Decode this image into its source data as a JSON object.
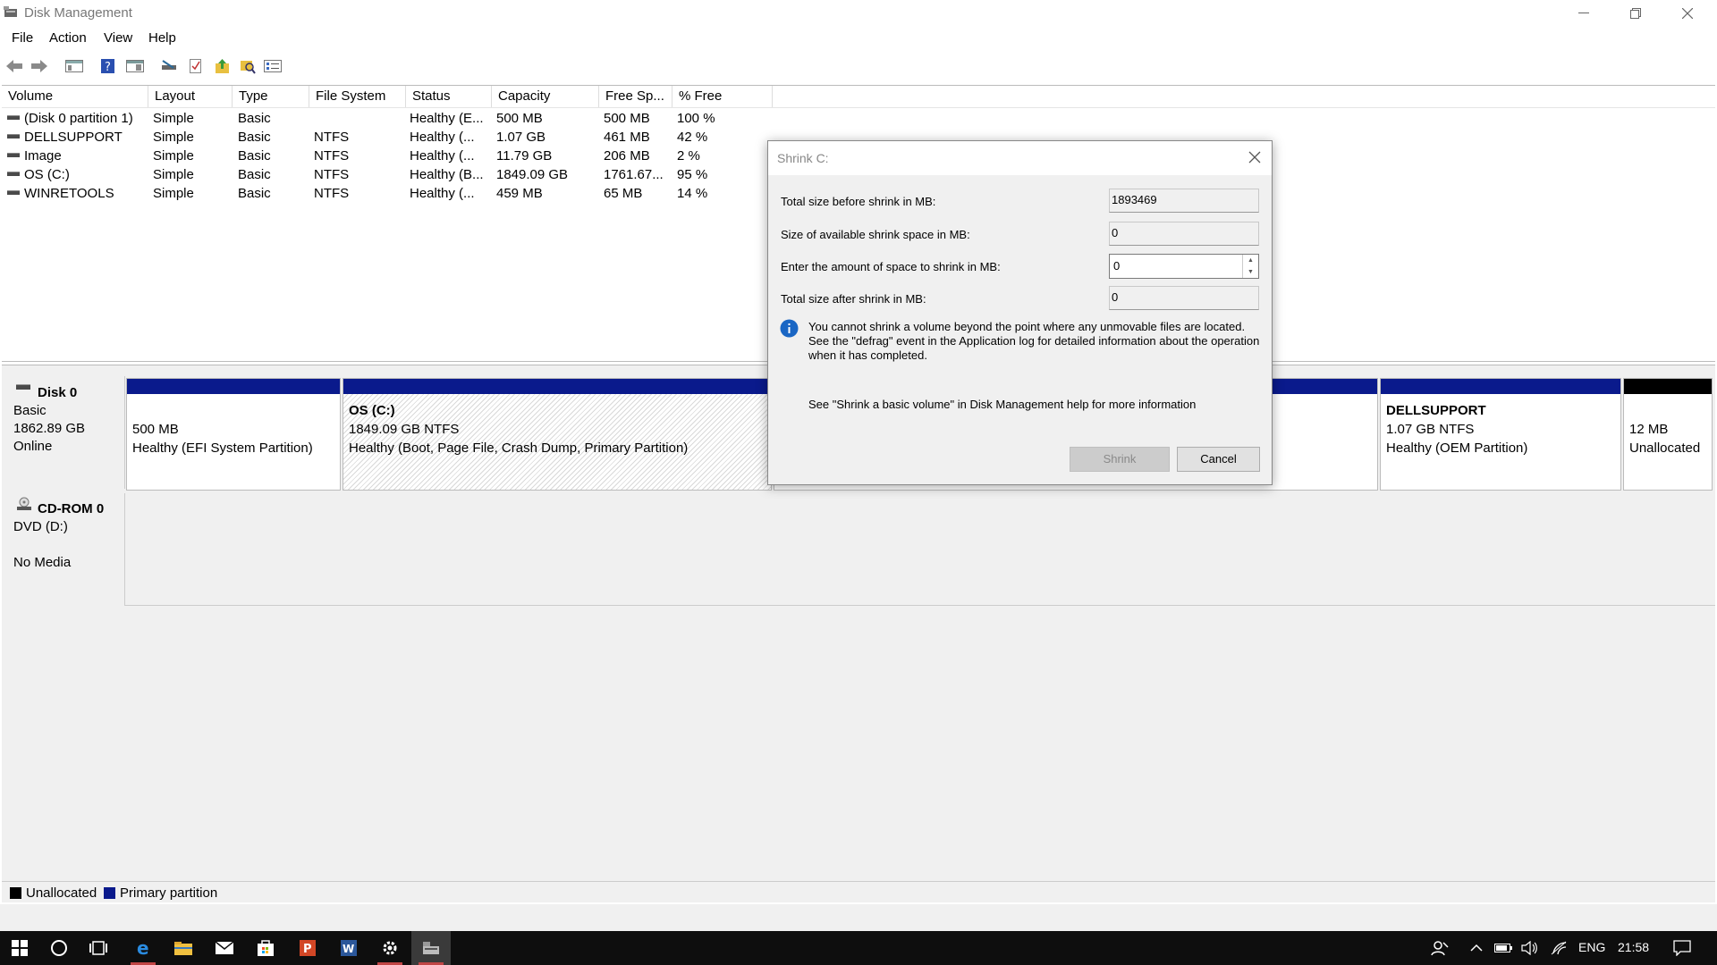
{
  "window": {
    "title": "Disk Management",
    "menu": [
      "File",
      "Action",
      "View",
      "Help"
    ]
  },
  "toolbar": {
    "icons": [
      "back-icon",
      "forward-icon",
      "console-tree-icon",
      "help-icon",
      "properties-pane-icon",
      "disk-icon",
      "checklist-icon",
      "folder-up-icon",
      "search-folder-icon",
      "settings-list-icon"
    ]
  },
  "volume_table": {
    "headers": [
      "Volume",
      "Layout",
      "Type",
      "File System",
      "Status",
      "Capacity",
      "Free Sp...",
      "% Free"
    ],
    "rows": [
      [
        "(Disk 0 partition 1)",
        "Simple",
        "Basic",
        "",
        "Healthy (E...",
        "500 MB",
        "500 MB",
        "100 %"
      ],
      [
        "DELLSUPPORT",
        "Simple",
        "Basic",
        "NTFS",
        "Healthy (...",
        "1.07 GB",
        "461 MB",
        "42 %"
      ],
      [
        "Image",
        "Simple",
        "Basic",
        "NTFS",
        "Healthy (...",
        "11.79 GB",
        "206 MB",
        "2 %"
      ],
      [
        "OS (C:)",
        "Simple",
        "Basic",
        "NTFS",
        "Healthy (B...",
        "1849.09 GB",
        "1761.67...",
        "95 %"
      ],
      [
        "WINRETOOLS",
        "Simple",
        "Basic",
        "NTFS",
        "Healthy (...",
        "459 MB",
        "65 MB",
        "14 %"
      ]
    ]
  },
  "disk0": {
    "name": "Disk 0",
    "type": "Basic",
    "size": "1862.89 GB",
    "status": "Online",
    "partitions": {
      "efi": {
        "size": "500 MB",
        "status": "Healthy (EFI System Partition)"
      },
      "os": {
        "name": "OS  (C:)",
        "size": "1849.09 GB NTFS",
        "status": "Healthy (Boot, Page File, Crash Dump, Primary Partition)"
      },
      "dellsupport": {
        "name": "DELLSUPPORT",
        "size": "1.07 GB NTFS",
        "status": "Healthy (OEM Partition)"
      },
      "unallocated": {
        "size": "12 MB",
        "status": "Unallocated"
      }
    }
  },
  "cdrom0": {
    "name": "CD-ROM 0",
    "type": "DVD (D:)",
    "status": "No Media"
  },
  "legend": {
    "unallocated": "Unallocated",
    "primary": "Primary partition"
  },
  "dialog": {
    "title": "Shrink C:",
    "total_before_label": "Total size before shrink in MB:",
    "total_before_value": "1893469",
    "available_label": "Size of available shrink space in MB:",
    "available_value": "0",
    "amount_label": "Enter the amount of space to shrink in MB:",
    "amount_value": "0",
    "after_label": "Total size after shrink in MB:",
    "after_value": "0",
    "info_text": "You cannot shrink a volume beyond the point where any unmovable files are located. See the \"defrag\" event in the Application log for detailed information about the operation when it has completed.",
    "help_text": "See \"Shrink a basic volume\" in Disk Management help for more information",
    "shrink_label": "Shrink",
    "cancel_label": "Cancel"
  },
  "taskbar": {
    "language": "ENG",
    "time": "21:58"
  },
  "colors": {
    "primary_partition": "#0a1a8c",
    "unallocated": "#000000",
    "taskbar": "#0e0e0e",
    "info_blue": "#1a66c4"
  }
}
